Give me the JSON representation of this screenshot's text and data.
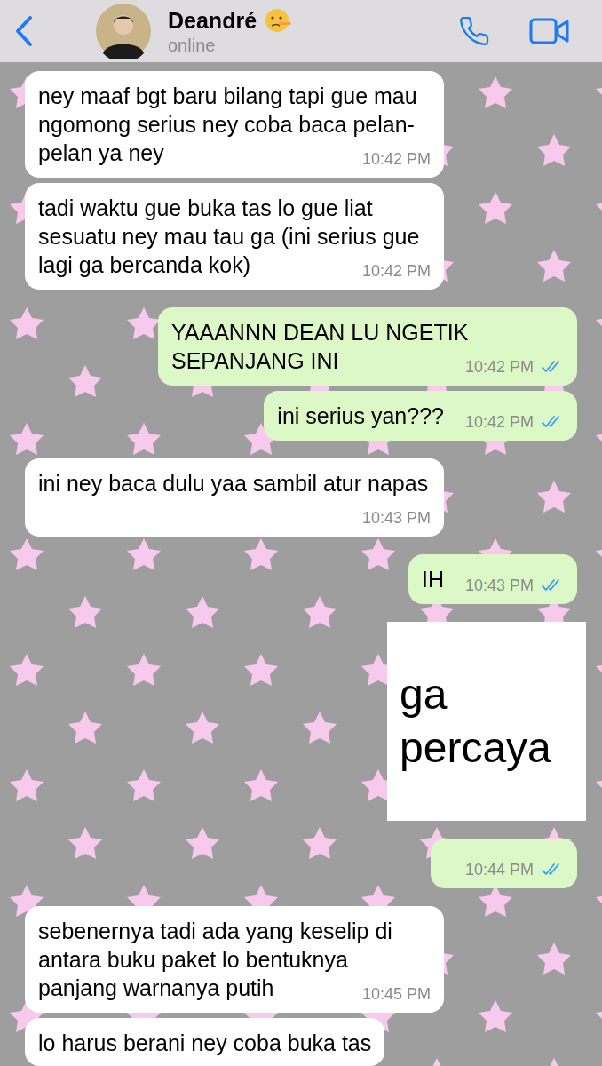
{
  "header": {
    "name": "Deandré",
    "status": "online"
  },
  "messages": [
    {
      "kind": "incoming",
      "text": "ney maaf bgt baru bilang tapi gue mau ngomong serius ney coba baca pelan-pelan ya ney",
      "time": "10:42 PM"
    },
    {
      "kind": "incoming",
      "text": "tadi waktu gue buka tas lo gue liat sesuatu ney mau tau ga (ini serius gue lagi ga bercanda kok)",
      "time": "10:42 PM"
    },
    {
      "kind": "outgoing",
      "text": "YAAANNN DEAN LU NGETIK SEPANJANG INI",
      "time": "10:42 PM",
      "read": true
    },
    {
      "kind": "outgoing",
      "text": "ini serius yan???",
      "time": "10:42 PM",
      "read": true
    },
    {
      "kind": "incoming",
      "text": "ini ney baca dulu yaa sambil atur napas",
      "time": "10:43 PM"
    },
    {
      "kind": "outgoing",
      "text": "IH",
      "time": "10:43 PM",
      "read": true
    },
    {
      "kind": "sticker",
      "text": "ga percaya"
    },
    {
      "kind": "outgoing",
      "time": "10:44 PM",
      "read": true
    },
    {
      "kind": "incoming",
      "text": "sebenernya tadi ada yang keselip di antara buku paket lo bentuknya panjang warnanya putih",
      "time": "10:45 PM"
    },
    {
      "kind": "incoming",
      "text": "lo harus berani ney coba buka tas"
    }
  ]
}
